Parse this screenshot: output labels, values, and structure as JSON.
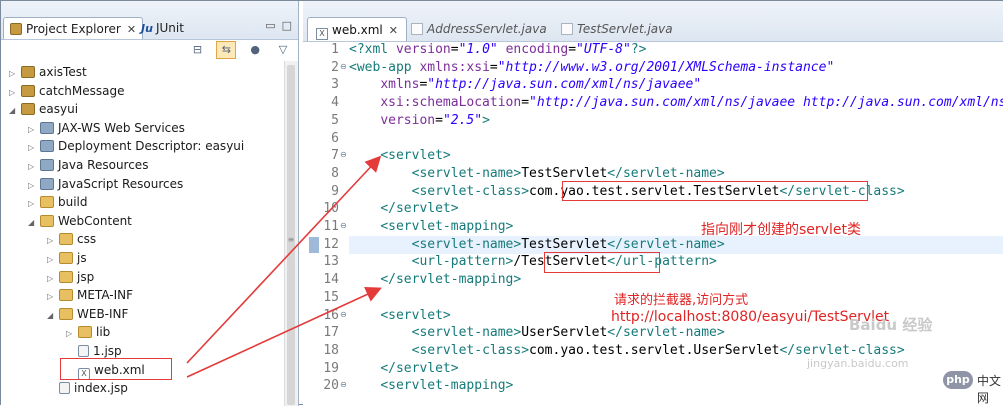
{
  "explorer": {
    "tabs": [
      {
        "label": "Project Explorer",
        "close": "✕"
      },
      {
        "label": "JUnit"
      }
    ],
    "toolbar": [
      "collapse-all",
      "link-with-editor",
      "filters",
      "view-menu"
    ],
    "tree": [
      {
        "label": "axisTest",
        "level": 0,
        "expanded": false
      },
      {
        "label": "catchMessage",
        "level": 0,
        "expanded": false
      },
      {
        "label": "easyui",
        "level": 0,
        "expanded": true
      },
      {
        "label": "JAX-WS Web Services",
        "level": 1,
        "expanded": false
      },
      {
        "label": "Deployment Descriptor: easyui",
        "level": 1,
        "expanded": false
      },
      {
        "label": "Java Resources",
        "level": 1,
        "expanded": false
      },
      {
        "label": "JavaScript Resources",
        "level": 1,
        "expanded": false
      },
      {
        "label": "build",
        "level": 1,
        "expanded": false
      },
      {
        "label": "WebContent",
        "level": 1,
        "expanded": true
      },
      {
        "label": "css",
        "level": 2,
        "expanded": false
      },
      {
        "label": "js",
        "level": 2,
        "expanded": false
      },
      {
        "label": "jsp",
        "level": 2,
        "expanded": false
      },
      {
        "label": "META-INF",
        "level": 2,
        "expanded": false
      },
      {
        "label": "WEB-INF",
        "level": 2,
        "expanded": true
      },
      {
        "label": "lib",
        "level": 3,
        "expanded": false
      },
      {
        "label": "1.jsp",
        "level": 3
      },
      {
        "label": "web.xml",
        "level": 3
      },
      {
        "label": "index.jsp",
        "level": 2
      }
    ]
  },
  "editor": {
    "tabs": [
      {
        "label": "web.xml",
        "active": true,
        "close": "✕"
      },
      {
        "label": "AddressServlet.java"
      },
      {
        "label": "TestServlet.java"
      }
    ],
    "line_numbers": [
      "1",
      "2",
      "3",
      "4",
      "5",
      "6",
      "7",
      "8",
      "9",
      "10",
      "11",
      "12",
      "13",
      "14",
      "15",
      "16",
      "17",
      "18",
      "19",
      "20"
    ],
    "annotations": {
      "servlet_class": "指向刚才创建的servlet类",
      "interceptor": "请求的拦截器,访问方式",
      "url": "http://localhost:8080/easyui/TestServlet"
    },
    "watermark": {
      "logo": "Baidu 经验",
      "site": "jingyan.baidu.com",
      "badge": "php",
      "badge_suffix": "中文网"
    }
  },
  "colors": {
    "tag": "#167a7a",
    "attribute": "#7d2e9a",
    "value": "#2a00ff",
    "annotation": "#e02424"
  }
}
